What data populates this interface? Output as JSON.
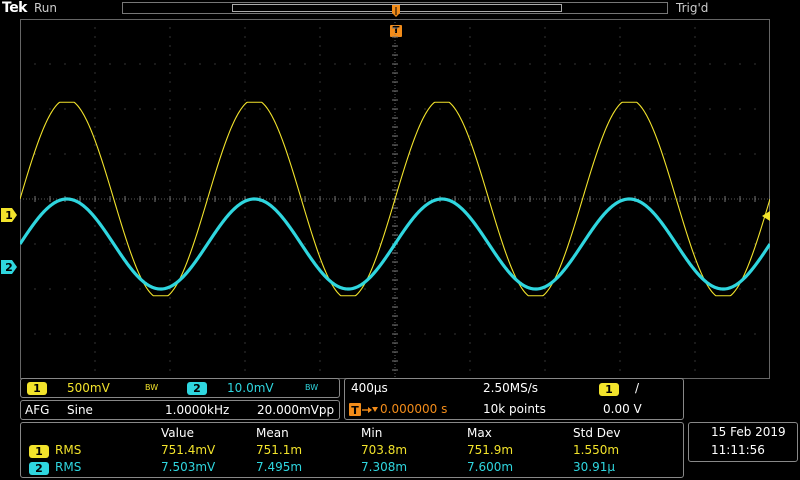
{
  "header": {
    "brand": "Tek",
    "status": "Run",
    "trigger_status": "Trig'd",
    "trigger_marker": "T"
  },
  "channels": [
    {
      "id": "1",
      "color": "#f2e32b",
      "scale": "500mV",
      "bw": "BW"
    },
    {
      "id": "2",
      "color": "#2fd6df",
      "scale": "10.0mV",
      "bw": "BW"
    }
  ],
  "afg": {
    "label": "AFG",
    "waveform": "Sine",
    "frequency": "1.0000kHz",
    "amplitude": "20.000mVpp"
  },
  "timebase": {
    "horizontal_scale": "400µs",
    "sample_rate": "2.50MS/s",
    "trigger_source": "1",
    "trigger_slope": "/",
    "trigger_position": "0.000000 s",
    "record_length": "10k points",
    "trigger_level": "0.00 V"
  },
  "measurements": {
    "headers": [
      "Value",
      "Mean",
      "Min",
      "Max",
      "Std Dev"
    ],
    "rows": [
      {
        "channel": "1",
        "type": "RMS",
        "values": [
          "751.4mV",
          "751.1m",
          "703.8m",
          "751.9m",
          "1.550m"
        ]
      },
      {
        "channel": "2",
        "type": "RMS",
        "values": [
          "7.503mV",
          "7.495m",
          "7.308m",
          "7.600m",
          "30.91µ"
        ]
      }
    ]
  },
  "datetime": {
    "date": "15 Feb  2019",
    "time": "11:11:56"
  },
  "chart_data": {
    "type": "line",
    "title": "",
    "xlabel": "",
    "ylabel": "",
    "x_unit": "s",
    "xlim": [
      -0.002,
      0.002
    ],
    "divisions": {
      "horizontal": 10,
      "vertical": 8
    },
    "grid": true,
    "series": [
      {
        "name": "1",
        "kind": "sine",
        "frequency_hz": 1000,
        "amplitude_div": 2.15,
        "offset_div": 0,
        "phase_deg": 0,
        "color": "#f2e32b"
      },
      {
        "name": "2",
        "kind": "sine",
        "frequency_hz": 1000,
        "amplitude_div": 1.0,
        "offset_div": -1.0,
        "phase_deg": 0,
        "color": "#2fd6df"
      }
    ]
  }
}
